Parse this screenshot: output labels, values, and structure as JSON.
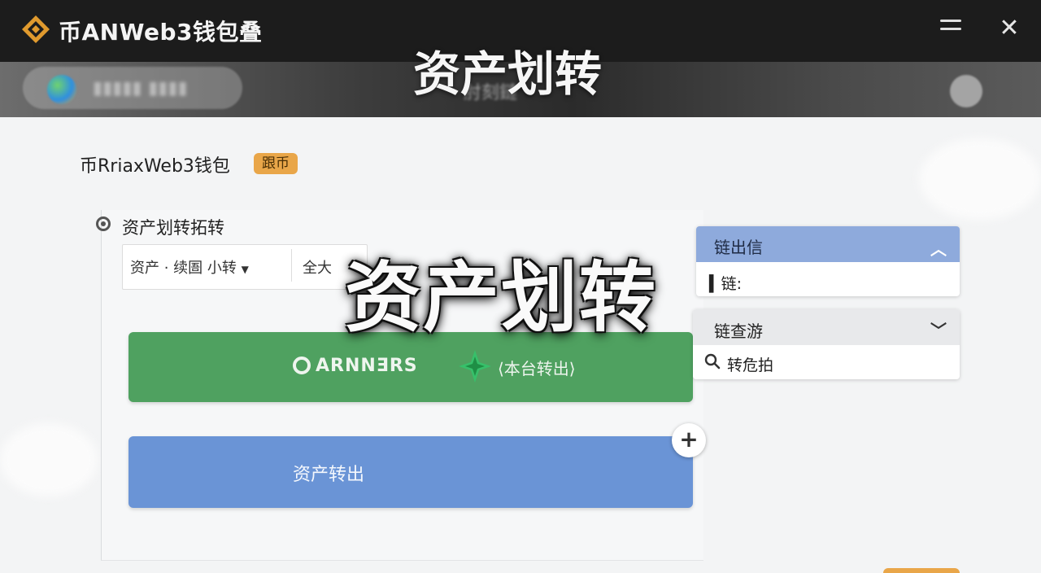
{
  "header": {
    "app_title": "币ANWeb3钱包叠",
    "hero_title": "资产划转",
    "hero_mid_text": "肘刻鏈"
  },
  "brand": {
    "name": "币RriaxWeb3钱包",
    "badge": "跟币"
  },
  "section": {
    "label": "资产划转拓转"
  },
  "filter": {
    "asset": "资产 · 续圄 小转",
    "all": "全大"
  },
  "center_title": "资产划转",
  "buttons": {
    "green_label": "ARNNƎRS",
    "green_sub": "⟨本台转出⟩",
    "blue_label": "资产转出",
    "plus": "+"
  },
  "panel_chain_out": {
    "title": "链出信",
    "row": "链:"
  },
  "panel_chain_select": {
    "title": "链查游",
    "row": "转危拍"
  },
  "colors": {
    "accent_green": "#4fa160",
    "accent_blue": "#6a94d6",
    "brand_orange": "#e9a649",
    "topbar": "#1c1c1c"
  },
  "icons": [
    "logo-diamond-icon",
    "menu-icon",
    "close-icon",
    "globe-icon",
    "user-icon",
    "radio-icon",
    "sparkle-star-icon",
    "plus-icon",
    "chevron-up-icon",
    "chevron-down-icon",
    "search-icon"
  ]
}
